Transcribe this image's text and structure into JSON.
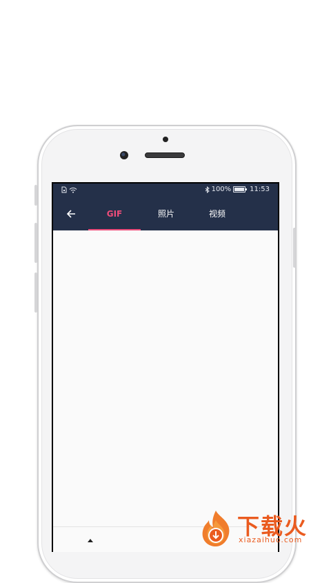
{
  "status_bar": {
    "battery_percent": "100%",
    "time": "11:53"
  },
  "toolbar": {
    "tabs": [
      {
        "label": "GIF",
        "active": true
      },
      {
        "label": "照片",
        "active": false
      },
      {
        "label": "视频",
        "active": false
      }
    ]
  },
  "watermark": {
    "title": "下载火",
    "url": "xiazaihuo.com"
  },
  "colors": {
    "appbar": "#243049",
    "accent": "#ee4d7a",
    "watermark": "#ea5b1f"
  }
}
